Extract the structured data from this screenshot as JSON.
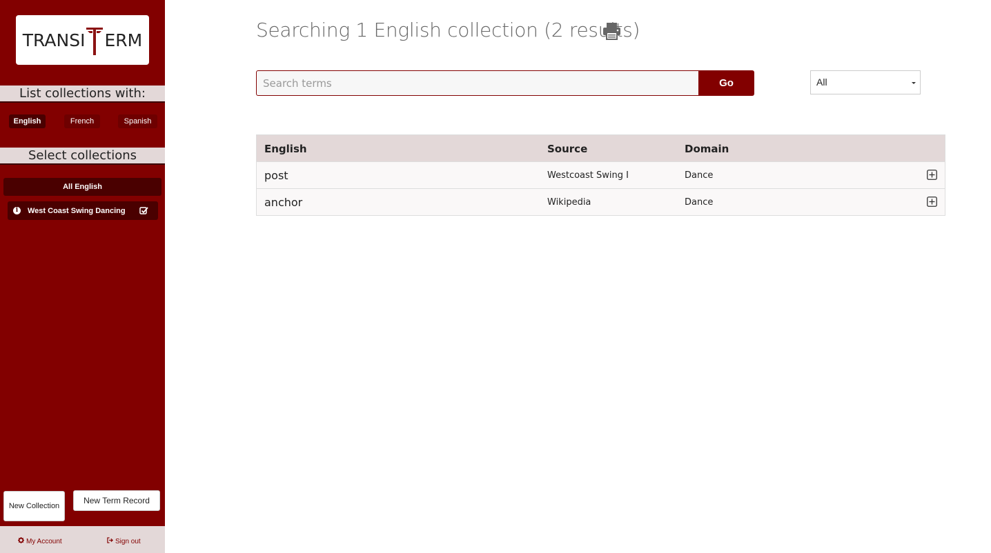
{
  "brand": {
    "logo_left": "TRANSI",
    "logo_right": "ERM",
    "accent": "#820000",
    "accent_dark": "#4a0000"
  },
  "sidebar": {
    "list_heading": "List collections with:",
    "languages": [
      {
        "label": "English",
        "active": true
      },
      {
        "label": "French",
        "active": false
      },
      {
        "label": "Spanish",
        "active": false
      }
    ],
    "select_heading": "Select collections",
    "all_label": "All English",
    "collections": [
      {
        "label": "West Coast Swing Dancing",
        "checked": true
      }
    ],
    "new_collection_label": "New Collection",
    "new_term_label": "New Term Record",
    "my_account_label": "My Account",
    "sign_out_label": "Sign out"
  },
  "main": {
    "title": "Searching 1 English collection (2 results)",
    "search_placeholder": "Search terms",
    "go_label": "Go",
    "filter_selected": "All",
    "table": {
      "headers": [
        "English",
        "Source",
        "Domain"
      ],
      "rows": [
        {
          "term": "post",
          "source": "Westcoast Swing I",
          "domain": "Dance"
        },
        {
          "term": "anchor",
          "source": "Wikipedia",
          "domain": "Dance"
        }
      ]
    }
  }
}
